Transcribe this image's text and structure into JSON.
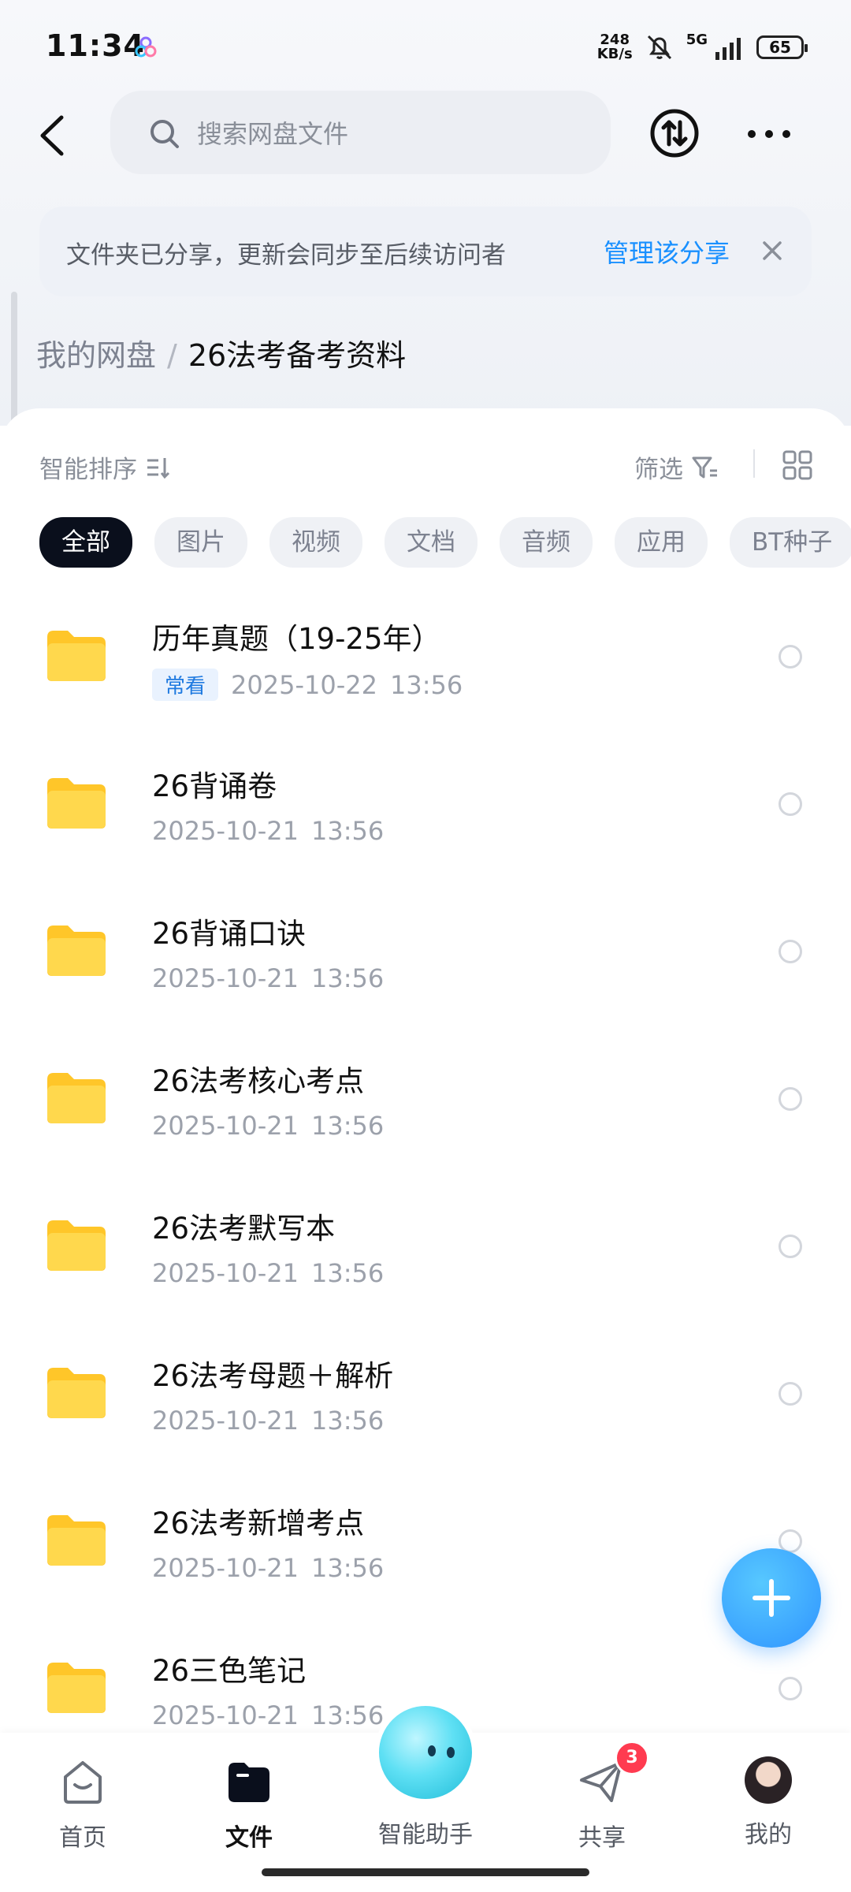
{
  "status_bar": {
    "time": "11:34",
    "net_speed_value": "248",
    "net_speed_unit": "KB/s",
    "network": "5G",
    "battery": "65"
  },
  "header": {
    "search_placeholder": "搜索网盘文件"
  },
  "share_banner": {
    "text": "文件夹已分享，更新会同步至后续访问者",
    "manage_label": "管理该分享"
  },
  "breadcrumb": {
    "root": "我的网盘",
    "separator": "/",
    "current": "26法考备考资料"
  },
  "toolbar": {
    "sort_label": "智能排序",
    "filter_label": "筛选"
  },
  "filters": [
    "全部",
    "图片",
    "视频",
    "文档",
    "音频",
    "应用",
    "BT种子"
  ],
  "files": [
    {
      "name": "历年真题（19-25年）",
      "tag": "常看",
      "date": "2025-10-22",
      "time": "13:56"
    },
    {
      "name": "26背诵卷",
      "date": "2025-10-21",
      "time": "13:56"
    },
    {
      "name": "26背诵口诀",
      "date": "2025-10-21",
      "time": "13:56"
    },
    {
      "name": "26法考核心考点",
      "date": "2025-10-21",
      "time": "13:56"
    },
    {
      "name": "26法考默写本",
      "date": "2025-10-21",
      "time": "13:56"
    },
    {
      "name": "26法考母题＋解析",
      "date": "2025-10-21",
      "time": "13:56"
    },
    {
      "name": "26法考新增考点",
      "date": "2025-10-21",
      "time": "13:56"
    },
    {
      "name": "26三色笔记",
      "date": "2025-10-21",
      "time": "13:56"
    }
  ],
  "tabbar": {
    "home": "首页",
    "files": "文件",
    "assistant": "智能助手",
    "share": "共享",
    "share_badge": "3",
    "me": "我的"
  },
  "colors": {
    "accent": "#1990ff",
    "folder": "#ffc629",
    "badge": "#ff3b50"
  }
}
